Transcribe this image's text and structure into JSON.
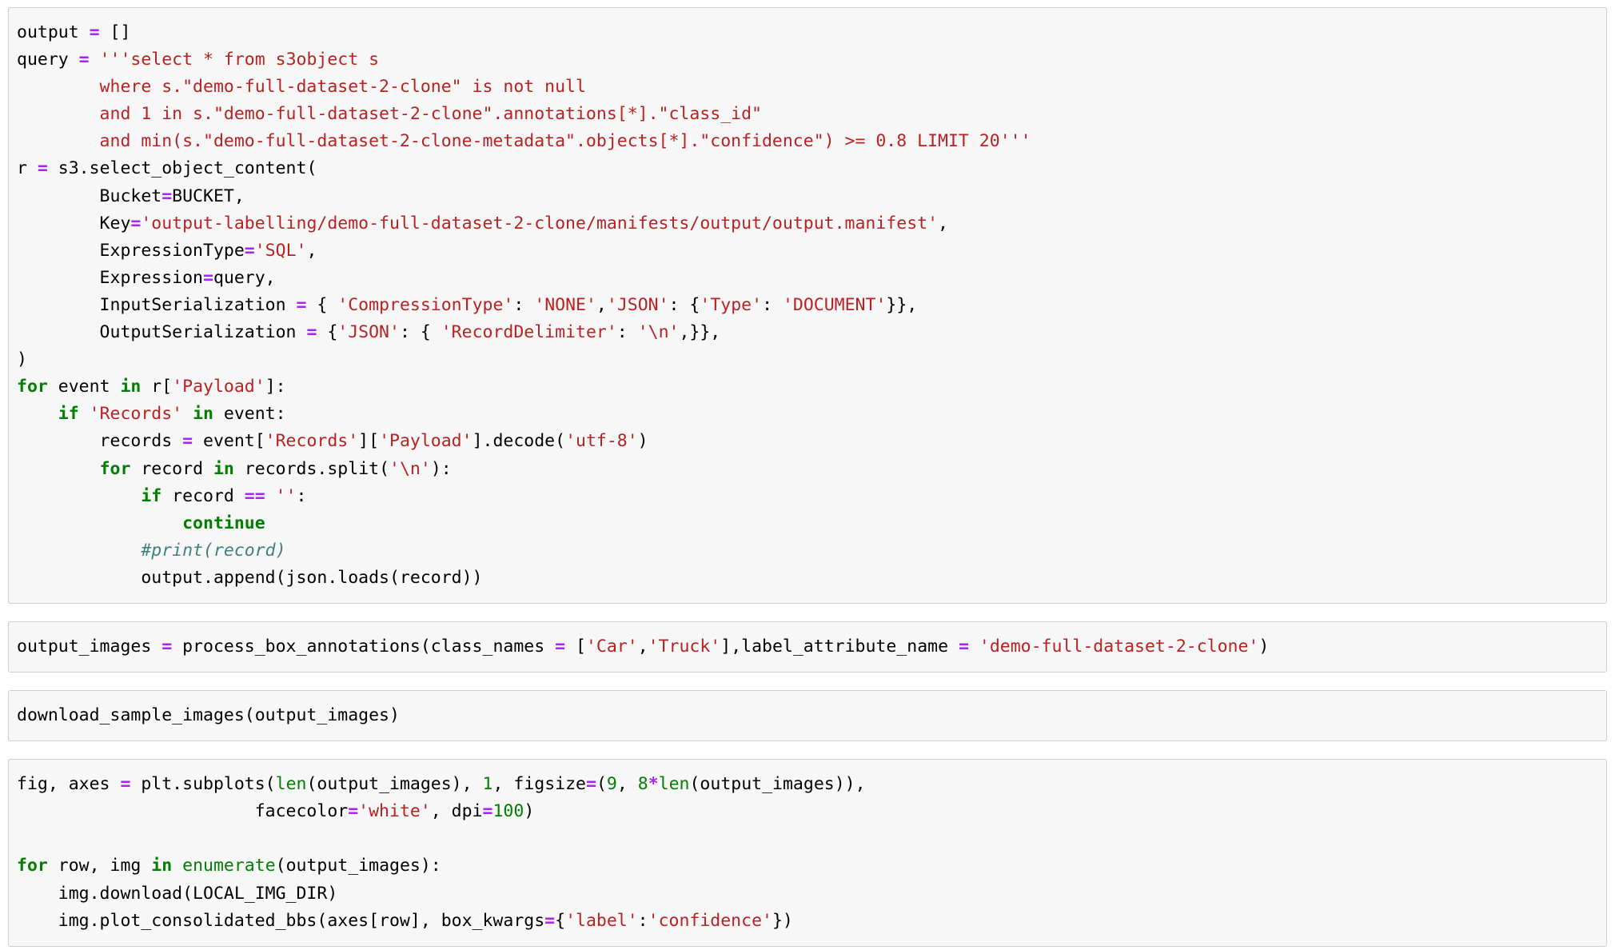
{
  "document": {
    "kind": "jupyter-notebook-code-cells",
    "background_color": "#ffffff",
    "cell_background_color": "#f7f7f7",
    "cell_border_color": "#cfcfcf"
  },
  "theme": {
    "keyword_color": "#008000",
    "builtin_color": "#008000",
    "operator_color": "#aa22ff",
    "string_color": "#ba2121",
    "number_color": "#008000",
    "comment_color": "#408080",
    "text_color": "#000000"
  },
  "cells": [
    {
      "index": 1,
      "name": "s3-select-query-cell",
      "lines": [
        [
          {
            "t": "output ",
            "c": "n"
          },
          {
            "t": "=",
            "c": "o"
          },
          {
            "t": " []",
            "c": "n"
          }
        ],
        [
          {
            "t": "query ",
            "c": "n"
          },
          {
            "t": "=",
            "c": "o"
          },
          {
            "t": " '''select * from s3object s",
            "c": "s"
          }
        ],
        [
          {
            "t": "        where s.\"demo-full-dataset-2-clone\" is not null",
            "c": "s"
          }
        ],
        [
          {
            "t": "        and 1 in s.\"demo-full-dataset-2-clone\".annotations[*].\"class_id\"",
            "c": "s"
          }
        ],
        [
          {
            "t": "        and min(s.\"demo-full-dataset-2-clone-metadata\".objects[*].\"confidence\") >= 0.8 LIMIT 20'''",
            "c": "s"
          }
        ],
        [
          {
            "t": "r ",
            "c": "n"
          },
          {
            "t": "=",
            "c": "o"
          },
          {
            "t": " s3.select_object_content(",
            "c": "n"
          }
        ],
        [
          {
            "t": "        Bucket",
            "c": "n"
          },
          {
            "t": "=",
            "c": "o"
          },
          {
            "t": "BUCKET,",
            "c": "n"
          }
        ],
        [
          {
            "t": "        Key",
            "c": "n"
          },
          {
            "t": "=",
            "c": "o"
          },
          {
            "t": "'output-labelling/demo-full-dataset-2-clone/manifests/output/output.manifest'",
            "c": "s"
          },
          {
            "t": ",",
            "c": "n"
          }
        ],
        [
          {
            "t": "        ExpressionType",
            "c": "n"
          },
          {
            "t": "=",
            "c": "o"
          },
          {
            "t": "'SQL'",
            "c": "s"
          },
          {
            "t": ",",
            "c": "n"
          }
        ],
        [
          {
            "t": "        Expression",
            "c": "n"
          },
          {
            "t": "=",
            "c": "o"
          },
          {
            "t": "query,",
            "c": "n"
          }
        ],
        [
          {
            "t": "        InputSerialization ",
            "c": "n"
          },
          {
            "t": "=",
            "c": "o"
          },
          {
            "t": " { ",
            "c": "n"
          },
          {
            "t": "'CompressionType'",
            "c": "s"
          },
          {
            "t": ": ",
            "c": "n"
          },
          {
            "t": "'NONE'",
            "c": "s"
          },
          {
            "t": ",",
            "c": "n"
          },
          {
            "t": "'JSON'",
            "c": "s"
          },
          {
            "t": ": {",
            "c": "n"
          },
          {
            "t": "'Type'",
            "c": "s"
          },
          {
            "t": ": ",
            "c": "n"
          },
          {
            "t": "'DOCUMENT'",
            "c": "s"
          },
          {
            "t": "}},",
            "c": "n"
          }
        ],
        [
          {
            "t": "        OutputSerialization ",
            "c": "n"
          },
          {
            "t": "=",
            "c": "o"
          },
          {
            "t": " {",
            "c": "n"
          },
          {
            "t": "'JSON'",
            "c": "s"
          },
          {
            "t": ": { ",
            "c": "n"
          },
          {
            "t": "'RecordDelimiter'",
            "c": "s"
          },
          {
            "t": ": ",
            "c": "n"
          },
          {
            "t": "'\\n'",
            "c": "s"
          },
          {
            "t": ",}},",
            "c": "n"
          }
        ],
        [
          {
            "t": ")",
            "c": "n"
          }
        ],
        [
          {
            "t": "for",
            "c": "k"
          },
          {
            "t": " event ",
            "c": "n"
          },
          {
            "t": "in",
            "c": "k"
          },
          {
            "t": " r[",
            "c": "n"
          },
          {
            "t": "'Payload'",
            "c": "s"
          },
          {
            "t": "]:",
            "c": "n"
          }
        ],
        [
          {
            "t": "    ",
            "c": "n"
          },
          {
            "t": "if",
            "c": "k"
          },
          {
            "t": " ",
            "c": "n"
          },
          {
            "t": "'Records'",
            "c": "s"
          },
          {
            "t": " ",
            "c": "n"
          },
          {
            "t": "in",
            "c": "k"
          },
          {
            "t": " event:",
            "c": "n"
          }
        ],
        [
          {
            "t": "        records ",
            "c": "n"
          },
          {
            "t": "=",
            "c": "o"
          },
          {
            "t": " event[",
            "c": "n"
          },
          {
            "t": "'Records'",
            "c": "s"
          },
          {
            "t": "][",
            "c": "n"
          },
          {
            "t": "'Payload'",
            "c": "s"
          },
          {
            "t": "].decode(",
            "c": "n"
          },
          {
            "t": "'utf-8'",
            "c": "s"
          },
          {
            "t": ")",
            "c": "n"
          }
        ],
        [
          {
            "t": "        ",
            "c": "n"
          },
          {
            "t": "for",
            "c": "k"
          },
          {
            "t": " record ",
            "c": "n"
          },
          {
            "t": "in",
            "c": "k"
          },
          {
            "t": " records.split(",
            "c": "n"
          },
          {
            "t": "'\\n'",
            "c": "s"
          },
          {
            "t": "):",
            "c": "n"
          }
        ],
        [
          {
            "t": "            ",
            "c": "n"
          },
          {
            "t": "if",
            "c": "k"
          },
          {
            "t": " record ",
            "c": "n"
          },
          {
            "t": "==",
            "c": "o"
          },
          {
            "t": " ",
            "c": "n"
          },
          {
            "t": "''",
            "c": "s"
          },
          {
            "t": ":",
            "c": "n"
          }
        ],
        [
          {
            "t": "                ",
            "c": "n"
          },
          {
            "t": "continue",
            "c": "k"
          }
        ],
        [
          {
            "t": "            ",
            "c": "n"
          },
          {
            "t": "#print(record)",
            "c": "c"
          }
        ],
        [
          {
            "t": "            output.append(json.loads(record))",
            "c": "n"
          }
        ]
      ]
    },
    {
      "index": 2,
      "name": "process-box-annotations-cell",
      "lines": [
        [
          {
            "t": "output_images ",
            "c": "n"
          },
          {
            "t": "=",
            "c": "o"
          },
          {
            "t": " process_box_annotations(class_names ",
            "c": "n"
          },
          {
            "t": "=",
            "c": "o"
          },
          {
            "t": " [",
            "c": "n"
          },
          {
            "t": "'Car'",
            "c": "s"
          },
          {
            "t": ",",
            "c": "n"
          },
          {
            "t": "'Truck'",
            "c": "s"
          },
          {
            "t": "],label_attribute_name ",
            "c": "n"
          },
          {
            "t": "=",
            "c": "o"
          },
          {
            "t": " ",
            "c": "n"
          },
          {
            "t": "'demo-full-dataset-2-clone'",
            "c": "s"
          },
          {
            "t": ")",
            "c": "n"
          }
        ]
      ]
    },
    {
      "index": 3,
      "name": "download-sample-images-cell",
      "lines": [
        [
          {
            "t": "download_sample_images(output_images)",
            "c": "n"
          }
        ]
      ]
    },
    {
      "index": 4,
      "name": "plot-subplots-cell",
      "lines": [
        [
          {
            "t": "fig, axes ",
            "c": "n"
          },
          {
            "t": "=",
            "c": "o"
          },
          {
            "t": " plt.subplots(",
            "c": "n"
          },
          {
            "t": "len",
            "c": "nb"
          },
          {
            "t": "(output_images), ",
            "c": "n"
          },
          {
            "t": "1",
            "c": "m"
          },
          {
            "t": ", figsize",
            "c": "n"
          },
          {
            "t": "=",
            "c": "o"
          },
          {
            "t": "(",
            "c": "n"
          },
          {
            "t": "9",
            "c": "m"
          },
          {
            "t": ", ",
            "c": "n"
          },
          {
            "t": "8",
            "c": "m"
          },
          {
            "t": "*",
            "c": "o"
          },
          {
            "t": "len",
            "c": "nb"
          },
          {
            "t": "(output_images)),",
            "c": "n"
          }
        ],
        [
          {
            "t": "                       facecolor",
            "c": "n"
          },
          {
            "t": "=",
            "c": "o"
          },
          {
            "t": "'white'",
            "c": "s"
          },
          {
            "t": ", dpi",
            "c": "n"
          },
          {
            "t": "=",
            "c": "o"
          },
          {
            "t": "100",
            "c": "m"
          },
          {
            "t": ")",
            "c": "n"
          }
        ],
        [
          {
            "t": "",
            "c": "n"
          }
        ],
        [
          {
            "t": "for",
            "c": "k"
          },
          {
            "t": " row, img ",
            "c": "n"
          },
          {
            "t": "in",
            "c": "k"
          },
          {
            "t": " ",
            "c": "n"
          },
          {
            "t": "enumerate",
            "c": "nb"
          },
          {
            "t": "(output_images):",
            "c": "n"
          }
        ],
        [
          {
            "t": "    img.download(LOCAL_IMG_DIR)",
            "c": "n"
          }
        ],
        [
          {
            "t": "    img.plot_consolidated_bbs(axes[row], box_kwargs",
            "c": "n"
          },
          {
            "t": "=",
            "c": "o"
          },
          {
            "t": "{",
            "c": "n"
          },
          {
            "t": "'label'",
            "c": "s"
          },
          {
            "t": ":",
            "c": "n"
          },
          {
            "t": "'confidence'",
            "c": "s"
          },
          {
            "t": "})",
            "c": "n"
          }
        ]
      ]
    }
  ]
}
